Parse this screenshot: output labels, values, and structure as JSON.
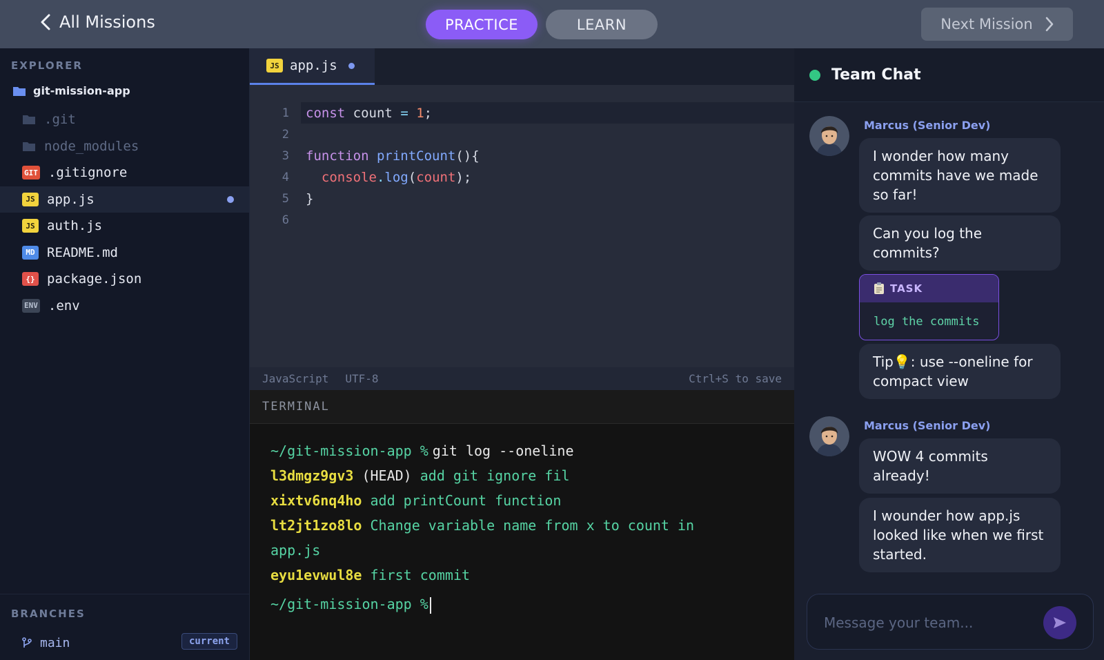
{
  "topbar": {
    "back_label": "All Missions",
    "tabs": [
      {
        "label": "PRACTICE",
        "active": true
      },
      {
        "label": "LEARN",
        "active": false
      }
    ],
    "next_label": "Next Mission"
  },
  "sidebar": {
    "explorer_title": "EXPLORER",
    "root_folder": "git-mission-app",
    "items": [
      {
        "name": ".git",
        "type": "folder"
      },
      {
        "name": "node_modules",
        "type": "folder"
      },
      {
        "name": ".gitignore",
        "badge": "GIT"
      },
      {
        "name": "app.js",
        "badge": "JS",
        "selected": true,
        "modified": true
      },
      {
        "name": "auth.js",
        "badge": "JS"
      },
      {
        "name": "README.md",
        "badge": "MD"
      },
      {
        "name": "package.json",
        "badge": "{}"
      },
      {
        "name": ".env",
        "badge": "ENV"
      }
    ],
    "branches_title": "BRANCHES",
    "branch": {
      "name": "main",
      "badge": "current"
    }
  },
  "editor": {
    "tab": {
      "badge": "JS",
      "name": "app.js",
      "modified": true
    },
    "line_numbers": [
      "1",
      "2",
      "3",
      "4",
      "5",
      "6"
    ],
    "code": {
      "l1": {
        "kw": "const",
        "var": "count",
        "op": "=",
        "num": "1",
        "end": ";"
      },
      "l3": {
        "kw": "function",
        "fn": "printCount",
        "paren": "(){"
      },
      "l4": {
        "obj": "console",
        "dot": ".",
        "method": "log",
        "open": "(",
        "arg": "count",
        "close": ");"
      },
      "l5": {
        "brace": "}"
      }
    },
    "status": {
      "language": "JavaScript",
      "encoding": "UTF-8",
      "hint": "Ctrl+S to save"
    }
  },
  "terminal": {
    "title": "TERMINAL",
    "prompt": "~/git-mission-app %",
    "command": "git log --oneline",
    "commits": [
      {
        "hash": "l3dmgz9gv3",
        "head": "(HEAD)",
        "message": "add git ignore fil"
      },
      {
        "hash": "xixtv6nq4ho",
        "head": "",
        "message": "add printCount function"
      },
      {
        "hash": "lt2jt1zo8lo",
        "head": "",
        "message": "Change variable name from x to count in",
        "message_cont": "app.js"
      },
      {
        "hash": "eyu1evwul8e",
        "head": "",
        "message": "first commit"
      }
    ]
  },
  "chat": {
    "title": "Team Chat",
    "sender": "Marcus (Senior Dev)",
    "group1": [
      "I wonder how many commits have we made so far!",
      "Can you log the commits?"
    ],
    "task": {
      "label": "TASK",
      "icon": "clipboard-icon",
      "text": "log the commits"
    },
    "tip": {
      "prefix": "Tip",
      "icon": "💡",
      "text": ": use --oneline for compact view"
    },
    "group2": [
      "WOW 4 commits already!",
      "I wounder how app.js looked like when we first started."
    ],
    "input_placeholder": "Message your team..."
  },
  "colors": {
    "accent": "#8b5cf6",
    "online": "#33c784",
    "hash": "#e8dd41",
    "terminal_text": "#56d4a4"
  }
}
